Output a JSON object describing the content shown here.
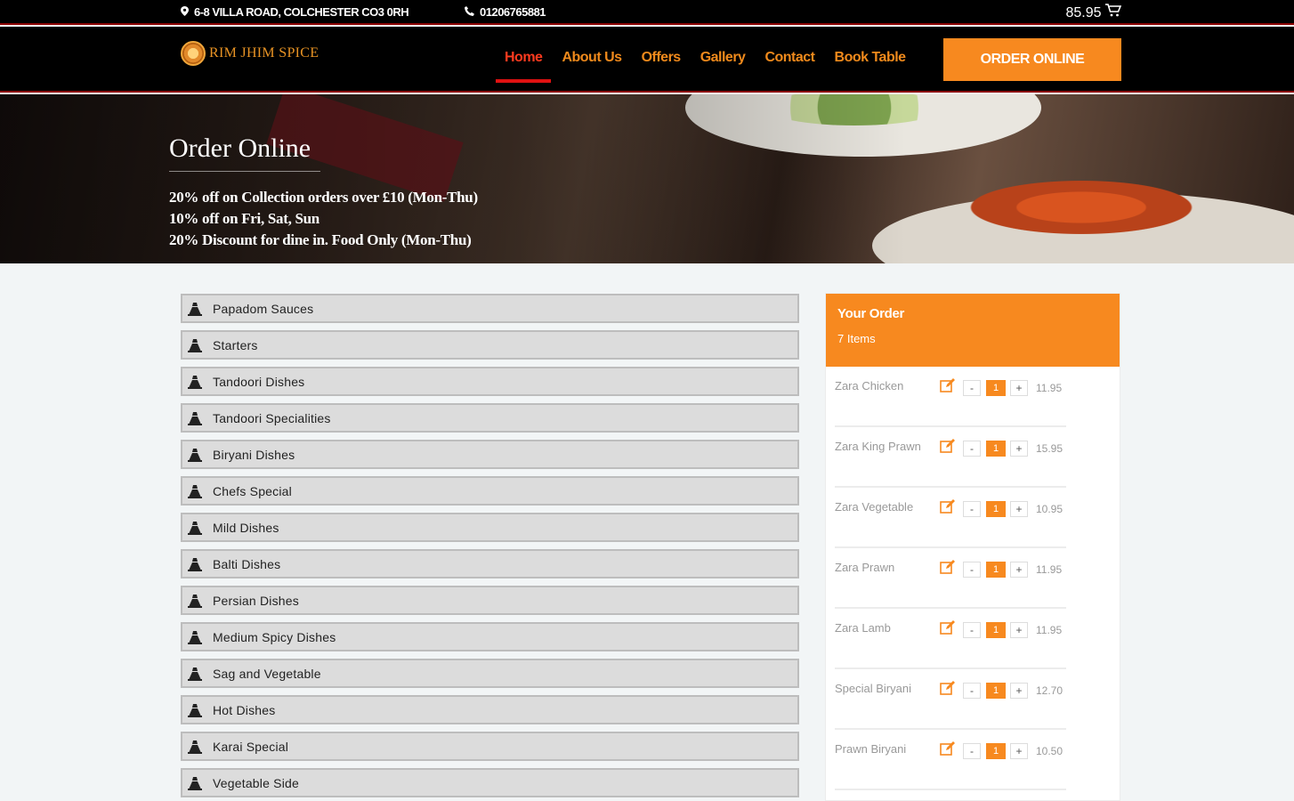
{
  "topbar": {
    "address": "6-8 VILLA ROAD, COLCHESTER CO3 0RH",
    "phone": "01206765881",
    "cart_total": "85.95"
  },
  "brand": {
    "name": "RIM JHIM SPICE"
  },
  "nav": {
    "items": [
      "Home",
      "About Us",
      "Offers",
      "Gallery",
      "Contact",
      "Book Table"
    ],
    "active": "Home",
    "cta": "ORDER ONLINE"
  },
  "hero": {
    "title": "Order Online",
    "offers": [
      "20% off on Collection orders over £10 (Mon-Thu)",
      "10% off on Fri, Sat, Sun",
      "20% Discount for dine in. Food Only (Mon-Thu)"
    ]
  },
  "categories": [
    "Papadom Sauces",
    "Starters",
    "Tandoori Dishes",
    "Tandoori Specialities",
    "Biryani Dishes",
    "Chefs Special",
    "Mild Dishes",
    "Balti Dishes",
    "Persian Dishes",
    "Medium Spicy Dishes",
    "Sag and Vegetable",
    "Hot Dishes",
    "Karai Special",
    "Vegetable Side"
  ],
  "order": {
    "title": "Your Order",
    "count": "7 Items",
    "items": [
      {
        "name": "Zara Chicken",
        "qty": "1",
        "price": "11.95"
      },
      {
        "name": "Zara King Prawn",
        "qty": "1",
        "price": "15.95"
      },
      {
        "name": "Zara Vegetable",
        "qty": "1",
        "price": "10.95"
      },
      {
        "name": "Zara Prawn",
        "qty": "1",
        "price": "11.95"
      },
      {
        "name": "Zara Lamb",
        "qty": "1",
        "price": "11.95"
      },
      {
        "name": "Special Biryani",
        "qty": "1",
        "price": "12.70"
      },
      {
        "name": "Prawn Biryani",
        "qty": "1",
        "price": "10.50"
      }
    ],
    "minus_label": "-",
    "plus_label": "+"
  },
  "colors": {
    "accent": "#f7891f",
    "active_nav": "#ff3b1f",
    "underline": "#e01111",
    "background": "#f2f5f6"
  },
  "icons": {
    "address": "map-pin-icon",
    "phone": "phone-icon",
    "cart": "cart-icon",
    "category": "fold-icon",
    "edit": "edit-icon"
  }
}
